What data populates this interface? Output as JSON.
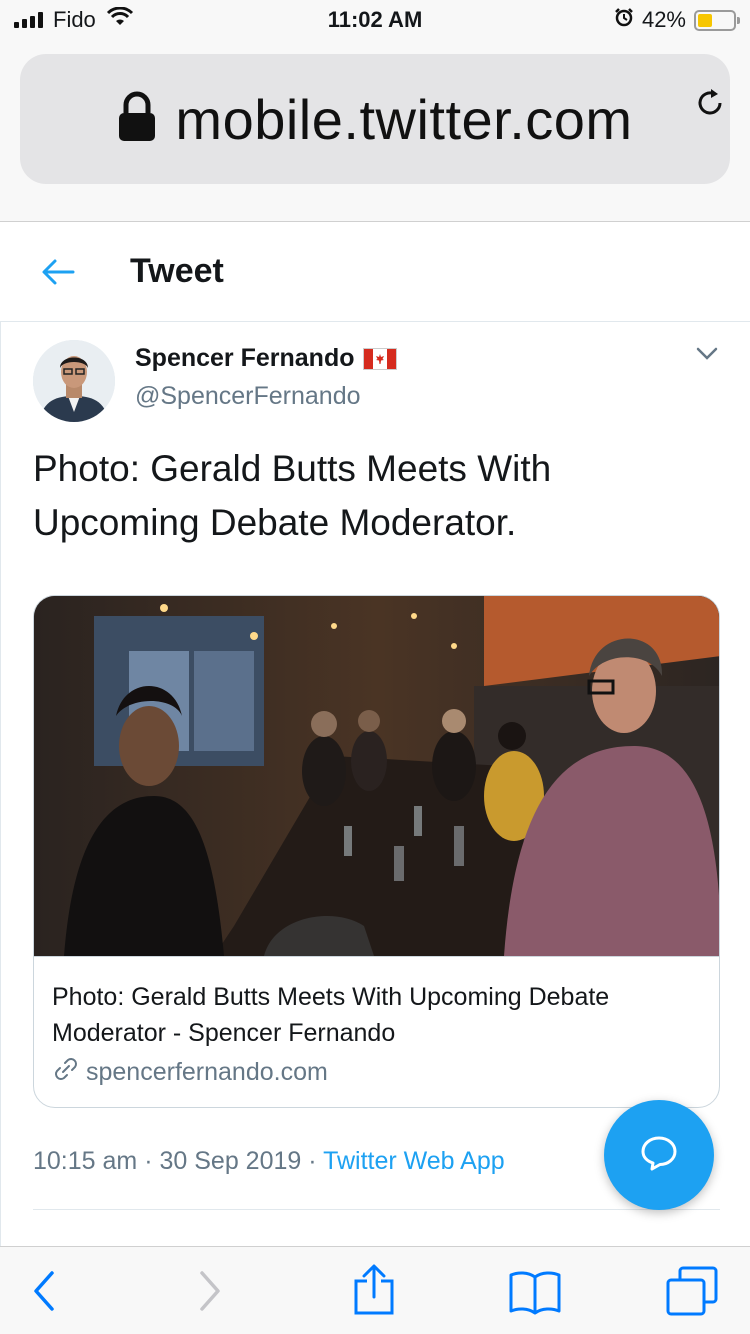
{
  "status_bar": {
    "carrier": "Fido",
    "time": "11:02 AM",
    "battery_percent": "42%",
    "battery_level": 0.42,
    "icons": [
      "signal-icon",
      "wifi-icon",
      "alarm-icon",
      "battery-icon"
    ]
  },
  "browser": {
    "url": "mobile.twitter.com",
    "lock_icon": "lock-icon",
    "reload_icon": "reload-icon"
  },
  "header": {
    "back_icon": "back-arrow-icon",
    "title": "Tweet"
  },
  "tweet": {
    "author_name": "Spencer Fernando",
    "author_flag": "canada-flag-icon",
    "handle": "@SpencerFernando",
    "text": "Photo: Gerald Butts Meets With Upcoming Debate Moderator.",
    "menu_icon": "chevron-down-icon",
    "card": {
      "title": "Photo: Gerald Butts Meets With Upcoming Debate Moderator - Spencer Fernando",
      "domain": "spencerfernando.com",
      "domain_icon": "link-icon"
    },
    "time": "10:15 am",
    "date": "30 Sep 2019",
    "separator": "·",
    "source": "Twitter Web App"
  },
  "fab": {
    "icon": "reply-bubble-icon"
  },
  "colors": {
    "twitter_blue": "#1da1f2",
    "secondary_text": "#657786",
    "ios_blue": "#007aff"
  },
  "toolbar": {
    "icons": [
      "back-chevron-icon",
      "forward-chevron-icon",
      "share-icon",
      "bookmarks-icon",
      "tabs-icon"
    ]
  }
}
